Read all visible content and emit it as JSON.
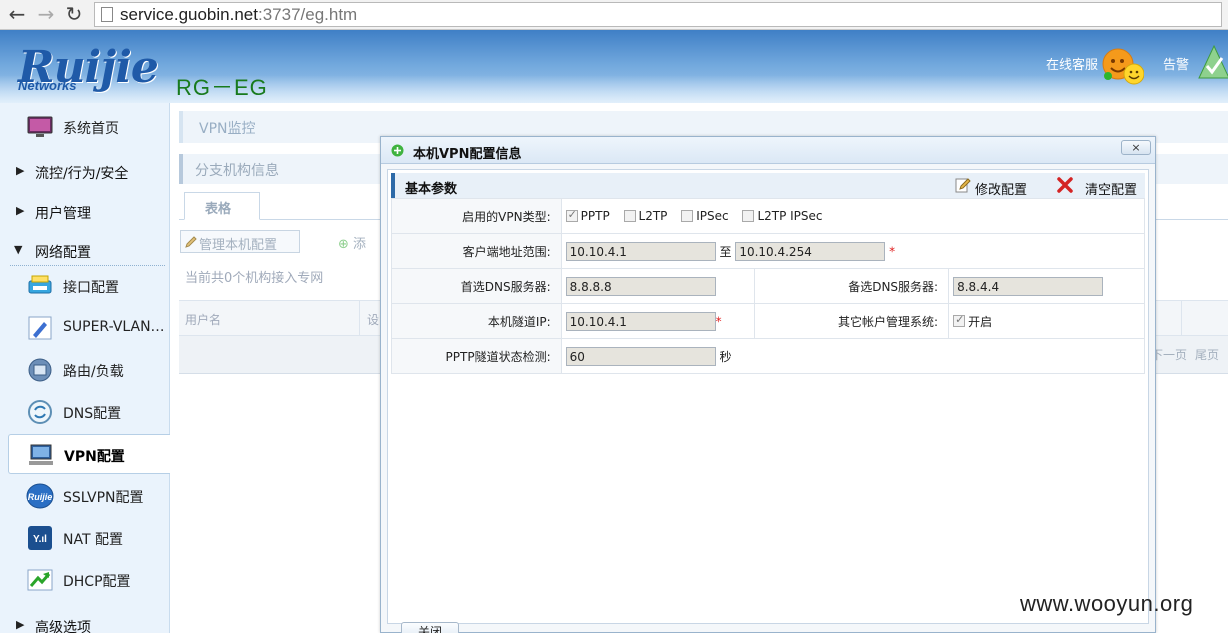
{
  "browser": {
    "url_host": "service.guobin.net",
    "url_rest": ":3737/eg.htm"
  },
  "header": {
    "logo": "Ruijie",
    "logo_sub": "Networks",
    "model": "RG－EG",
    "online_service": "在线客服",
    "alert": "告警"
  },
  "sidebar": {
    "home": "系统首页",
    "groups": [
      "流控/行为/安全",
      "用户管理",
      "网络配置",
      "高级选项"
    ],
    "items": [
      "接口配置",
      "SUPER-VLAN…",
      "路由/负载",
      "DNS配置",
      "VPN配置",
      "SSLVPN配置",
      "NAT 配置",
      "DHCP配置"
    ]
  },
  "content": {
    "crumb": "VPN监控",
    "section": "分支机构信息",
    "tab": "表格",
    "manage_btn": "管理本机配置",
    "add_btn": "添",
    "count": "当前共0个机构接入专网",
    "col_user": "用户名",
    "col_dev": "设",
    "pager_next": "下一页",
    "pager_last": "尾页"
  },
  "modal": {
    "title": "本机VPN配置信息",
    "close": "×",
    "panel_title": "基本参数",
    "edit_btn": "修改配置",
    "clear_btn": "清空配置",
    "vpn_type_label": "启用的VPN类型:",
    "vpn_types": [
      {
        "label": "PPTP",
        "checked": true
      },
      {
        "label": "L2TP",
        "checked": false
      },
      {
        "label": "IPSec",
        "checked": false
      },
      {
        "label": "L2TP IPSec",
        "checked": false
      }
    ],
    "client_range_label": "客户端地址范围:",
    "client_range_start": "10.10.4.1",
    "range_to": "至",
    "client_range_end": "10.10.4.254",
    "dns1_label": "首选DNS服务器:",
    "dns1": "8.8.8.8",
    "dns2_label": "备选DNS服务器:",
    "dns2": "8.8.4.4",
    "tunnel_ip_label": "本机隧道IP:",
    "tunnel_ip": "10.10.4.1",
    "other_mgmt_label": "其它帐户管理系统:",
    "other_mgmt_value": "开启",
    "pptp_check_label": "PPTP隧道状态检测:",
    "pptp_check_value": "60",
    "pptp_check_unit": "秒",
    "close_btn": "关闭"
  },
  "watermark": "www.wooyun.org"
}
